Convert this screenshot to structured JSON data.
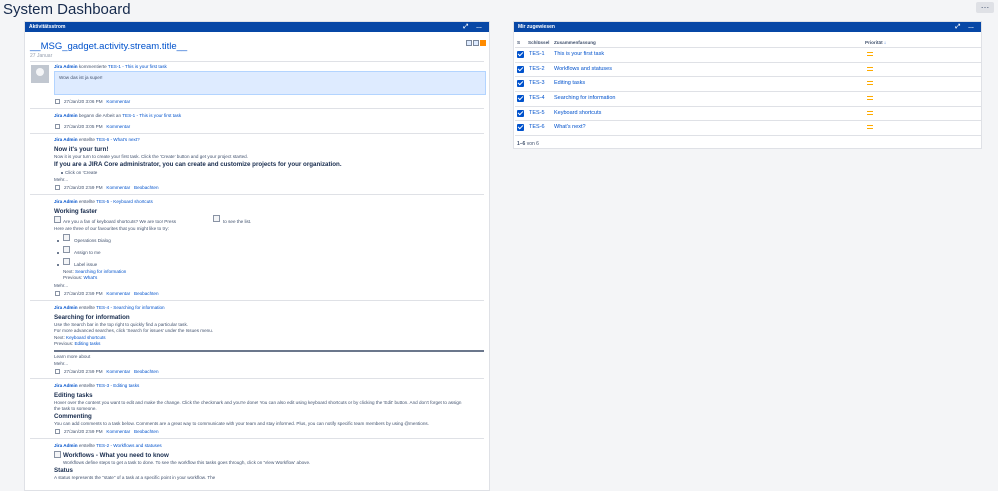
{
  "page": {
    "title": "System Dashboard",
    "more": "…"
  },
  "activity": {
    "header": "Aktivitätsstrom",
    "ctrls": "⤢ …",
    "title": "__MSG_gadget.activity.stream.title__",
    "date": "27 Januar",
    "entries": [
      {
        "user": "Jira Admin",
        "verb": "kommentierte",
        "key": "TES-1",
        "summary": "- This is your first task",
        "comment": "Wow das ist ja super!",
        "time": "27/Jan/20 3:06 PM",
        "actions": [
          "Kommentar"
        ]
      },
      {
        "user": "Jira Admin",
        "verb": "begann die Arbeit an",
        "key": "TES-1",
        "summary": "- This is your first task",
        "time": "27/Jan/20 3:05 PM",
        "actions": [
          "Kommentar"
        ]
      },
      {
        "user": "Jira Admin",
        "verb": "erstellte",
        "key": "TES-6",
        "summary": "- What's next?",
        "heading": "Now it's your turn!",
        "line1": "Now it is your turn to create your first task. Click the 'Create' button and get your project started.",
        "bold": "If you are a JIRA Core administrator, you can create and customize projects for your organization.",
        "bullet": "Click on 'Create",
        "more": "Mehr...",
        "time": "27/Jan/20 2:59 PM",
        "actions": [
          "Kommentar",
          "Beobachten"
        ]
      },
      {
        "user": "Jira Admin",
        "verb": "erstellte",
        "key": "TES-5",
        "summary": "- Keyboard shortcuts",
        "heading": "Working faster",
        "line1": "Are you a fan of keyboard shortcuts? We are too! Press",
        "line1b": "to see the list.",
        "line2": "Here are three of our favourites that you might like to try:",
        "items": [
          "Operations Dialog",
          "Assign to me",
          "Label issue"
        ],
        "next_label": "Next:",
        "next": "Searching for information",
        "prev_label": "Previous:",
        "prev": "What's",
        "more": "Mehr...",
        "time": "27/Jan/20 2:59 PM",
        "actions": [
          "Kommentar",
          "Beobachten"
        ]
      },
      {
        "user": "Jira Admin",
        "verb": "erstellte",
        "key": "TES-4",
        "summary": "- Searching for information",
        "heading": "Searching for information",
        "line1": "Use the Search bar in the top right to quickly find a particular task.",
        "line2": "For more advanced searches, click 'Search for issues' under the Issues menu.",
        "next_label": "Next:",
        "next": "Keyboard shortcuts",
        "prev_label": "Previous:",
        "prev": "Editing tasks",
        "learn": "Learn more about",
        "more": "Mehr...",
        "time": "27/Jan/20 2:59 PM",
        "actions": [
          "Kommentar",
          "Beobachten"
        ]
      },
      {
        "user": "Jira Admin",
        "verb": "erstellte",
        "key": "TES-3",
        "summary": "- Editing tasks",
        "heading": "Editing tasks",
        "line1": "Hover over the content you want to edit and make the change. Click the checkmark and you're done! You can also edit using keyboard shortcuts or by clicking the 'Edit' button. And don't forget to assign",
        "line1b": "the task to someone.",
        "heading2": "Commenting",
        "line2": "You can add comments to a task below. Comments are a great way to communicate with your team and stay informed. Plus, you can notify specific team members by using @mentions.",
        "time": "27/Jan/20 2:59 PM",
        "actions": [
          "Kommentar",
          "Beobachten"
        ]
      },
      {
        "user": "Jira Admin",
        "verb": "erstellte",
        "key": "TES-2",
        "summary": "- Workflows and statuses",
        "heading": "Workflows - What you need to know",
        "line1": "Workflows define steps to get a task to done. To see the workflow this tasks goes through, click on 'View Workflow' above.",
        "heading2": "Status",
        "line2": "A status represents the \"state\" of a task at a specific point in your workflow. The"
      }
    ]
  },
  "assigned": {
    "header": "Mir zugewiesen",
    "ctrls": "⤢ …",
    "columns": {
      "type": "S",
      "key": "Schlüssel",
      "summary": "Zusammenfassung",
      "priority": "Priorität",
      "sort": "↓"
    },
    "rows": [
      {
        "key": "TES-1",
        "summary": "This is your first task",
        "priority": "medium"
      },
      {
        "key": "TES-2",
        "summary": "Workflows and statuses",
        "priority": "medium"
      },
      {
        "key": "TES-3",
        "summary": "Editing tasks",
        "priority": "medium"
      },
      {
        "key": "TES-4",
        "summary": "Searching for information",
        "priority": "medium"
      },
      {
        "key": "TES-5",
        "summary": "Keyboard shortcuts",
        "priority": "medium"
      },
      {
        "key": "TES-6",
        "summary": "What's next?",
        "priority": "medium"
      }
    ],
    "pager": {
      "range": "1–6",
      "of": "von 6"
    }
  },
  "colors": {
    "header": "#0747a6",
    "link": "#0052cc",
    "priority_medium": "#ffab00"
  },
  "icons": [
    "more-icon",
    "expand-icon",
    "avatar-icon",
    "checkbox-icon",
    "priority-medium-icon",
    "rss-icon",
    "filter-icon"
  ]
}
